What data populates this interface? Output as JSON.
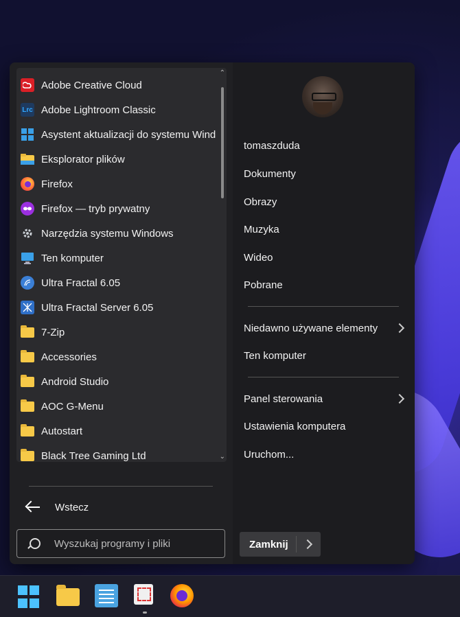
{
  "programs": [
    {
      "label": "Adobe Creative Cloud",
      "icon": "adobe-cc-icon",
      "color": "#da1f26"
    },
    {
      "label": "Adobe Lightroom Classic",
      "icon": "lightroom-icon",
      "color": "#1e3a5f",
      "badge": "Lrc"
    },
    {
      "label": "Asystent aktualizacji do systemu Windows",
      "icon": "windows-update-icon",
      "color": "#3aa0e8"
    },
    {
      "label": "Eksplorator plików",
      "icon": "file-explorer-icon",
      "color": "#f7c948"
    },
    {
      "label": "Firefox",
      "icon": "firefox-icon",
      "color": "#ff7139"
    },
    {
      "label": "Firefox — tryb prywatny",
      "icon": "firefox-private-icon",
      "color": "#9b2fe0"
    },
    {
      "label": "Narzędzia systemu Windows",
      "icon": "windows-tools-icon",
      "color": "#9aa0a6"
    },
    {
      "label": "Ten komputer",
      "icon": "computer-icon",
      "color": "#3aa0e8"
    },
    {
      "label": "Ultra Fractal 6.05",
      "icon": "ultra-fractal-icon",
      "color": "#3b7fd6"
    },
    {
      "label": "Ultra Fractal Server 6.05",
      "icon": "ultra-fractal-server-icon",
      "color": "#2f6fc7"
    },
    {
      "label": "7-Zip",
      "icon": "folder-icon",
      "color": "#f7c948"
    },
    {
      "label": "Accessories",
      "icon": "folder-icon",
      "color": "#f7c948"
    },
    {
      "label": "Android Studio",
      "icon": "folder-icon",
      "color": "#f7c948"
    },
    {
      "label": "AOC G-Menu",
      "icon": "folder-icon",
      "color": "#f7c948"
    },
    {
      "label": "Autostart",
      "icon": "folder-icon",
      "color": "#f7c948"
    },
    {
      "label": "Black Tree Gaming Ltd",
      "icon": "folder-icon",
      "color": "#f7c948"
    }
  ],
  "back_label": "Wstecz",
  "search": {
    "placeholder": "Wyszukaj programy i pliki"
  },
  "right": {
    "username": "tomaszduda",
    "items": [
      {
        "label": "Dokumenty"
      },
      {
        "label": "Obrazy"
      },
      {
        "label": "Muzyka"
      },
      {
        "label": "Wideo"
      },
      {
        "label": "Pobrane"
      }
    ],
    "recent": "Niedawno używane elementy",
    "this_pc": "Ten komputer",
    "control_panel": "Panel sterowania",
    "pc_settings": "Ustawienia komputera",
    "run": "Uruchom...",
    "shutdown": "Zamknij"
  },
  "taskbar": [
    "windows-start-icon",
    "file-explorer-icon",
    "notepad-icon",
    "snipping-tool-icon",
    "firefox-icon"
  ]
}
